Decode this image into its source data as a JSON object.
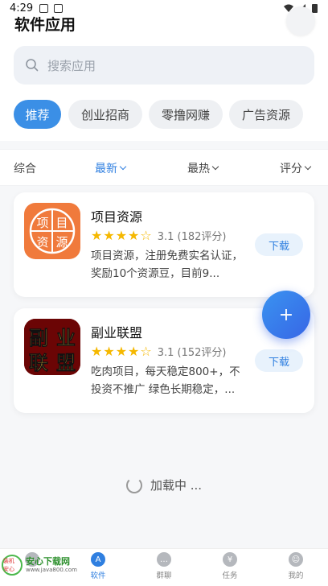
{
  "status_bar": {
    "time": "4:29"
  },
  "header": {
    "title": "软件应用"
  },
  "search": {
    "placeholder": "搜索应用"
  },
  "categories": [
    {
      "label": "推荐",
      "active": true
    },
    {
      "label": "创业招商",
      "active": false
    },
    {
      "label": "零撸网赚",
      "active": false
    },
    {
      "label": "广告资源",
      "active": false
    }
  ],
  "sort": [
    {
      "label": "综合",
      "active": false
    },
    {
      "label": "最新",
      "active": true
    },
    {
      "label": "最热",
      "active": false
    },
    {
      "label": "评分",
      "active": false
    }
  ],
  "apps": [
    {
      "name": "项目资源",
      "icon_chars": [
        "项",
        "目",
        "资",
        "源"
      ],
      "stars": 4,
      "rating_text": "3.1 (182评分)",
      "description": "项目资源，注册免费实名认证，奖励10个资源豆，目前9...",
      "download_label": "下载"
    },
    {
      "name": "副业联盟",
      "icon_chars": [
        "副",
        "业",
        "联",
        "盟"
      ],
      "stars": 4,
      "rating_text": "3.1 (152评分)",
      "description": "吃肉项目，每天稳定800+，不投资不推广 绿色长期稳定，...",
      "download_label": "下载"
    }
  ],
  "fab": {
    "symbol": "+"
  },
  "loading": {
    "text": "加载中 ..."
  },
  "bottom_nav": [
    {
      "label": "",
      "icon": "home-icon",
      "active": false
    },
    {
      "label": "软件",
      "icon": "app-store-icon",
      "active": true
    },
    {
      "label": "群聊",
      "icon": "chat-icon",
      "active": false
    },
    {
      "label": "任务",
      "icon": "task-icon",
      "active": false
    },
    {
      "label": "我的",
      "icon": "profile-icon",
      "active": false
    }
  ],
  "watermark": {
    "title": "安心下载网",
    "url": "www.java800.com",
    "logo_text": "装机 安心"
  },
  "colors": {
    "accent": "#2f7fe0",
    "star": "#f5b800",
    "icon1_bg": "#f07a3c",
    "icon2_bg": "#8a0d0d"
  }
}
